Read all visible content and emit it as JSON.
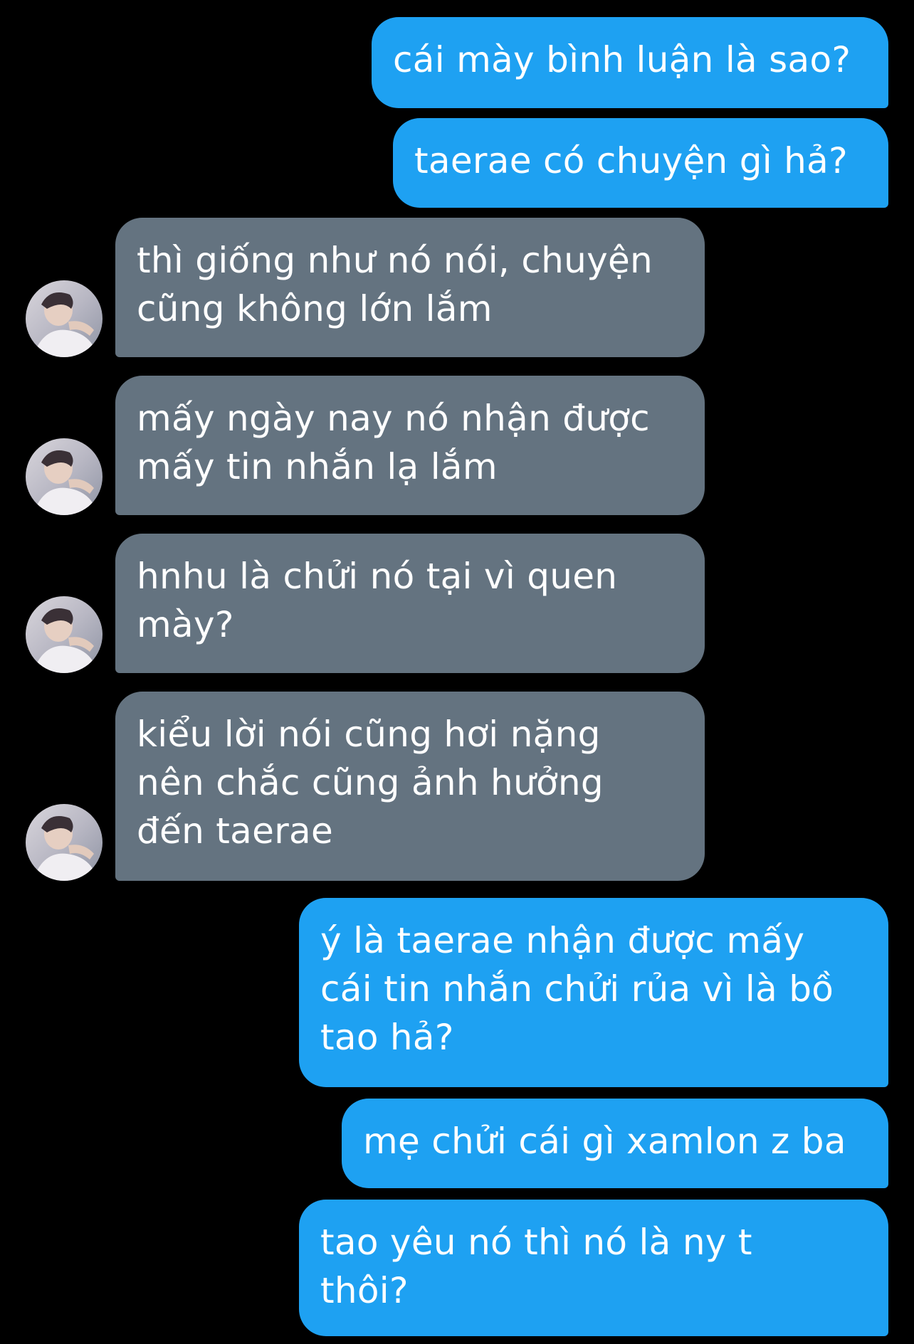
{
  "colors": {
    "background": "#000000",
    "sent_bubble": "#1ea1f2",
    "received_bubble": "#647380",
    "text": "#ffffff"
  },
  "messages": [
    {
      "side": "sent",
      "text": "cái mày bình luận là sao?"
    },
    {
      "side": "sent",
      "text": "taerae có chuyện gì hả?"
    },
    {
      "side": "received",
      "text": "thì giống như nó nói, chuyện\ncũng không lớn lắm",
      "avatar": "contact-avatar"
    },
    {
      "side": "received",
      "text": "mấy ngày nay nó nhận được\nmấy tin nhắn lạ lắm",
      "avatar": "contact-avatar"
    },
    {
      "side": "received",
      "text": "hnhu là chửi nó tại vì quen\nmày?",
      "avatar": "contact-avatar"
    },
    {
      "side": "received",
      "text": "kiểu lời nói cũng hơi nặng\nnên chắc cũng ảnh hưởng\nđến taerae",
      "avatar": "contact-avatar"
    },
    {
      "side": "sent",
      "text": "ý là taerae nhận được mấy\ncái tin nhắn chửi rủa vì là bồ\ntao hả?"
    },
    {
      "side": "sent",
      "text": "mẹ chửi cái gì xamlon z ba"
    },
    {
      "side": "sent",
      "text": "tao yêu nó thì nó là ny t\nthôi?"
    }
  ]
}
